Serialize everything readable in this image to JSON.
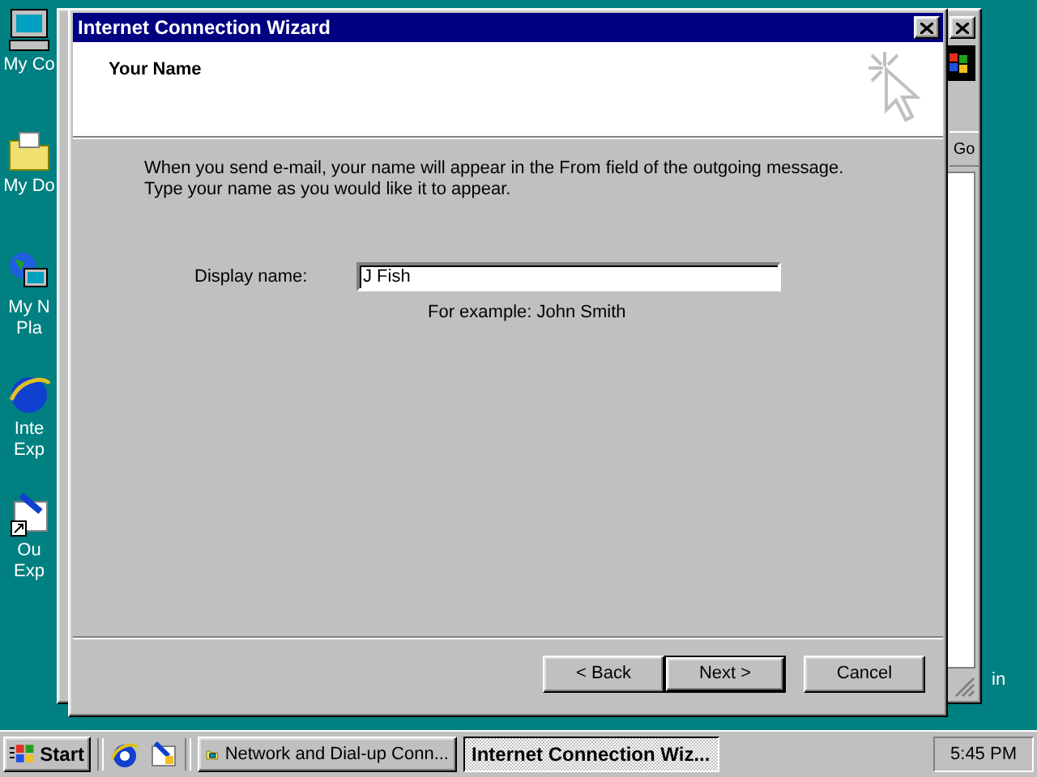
{
  "desktop": {
    "icons": [
      {
        "kind": "computer",
        "lines": [
          "My Co"
        ]
      },
      {
        "kind": "folder",
        "lines": [
          "My Do"
        ]
      },
      {
        "kind": "network",
        "lines": [
          "My N",
          "Pla"
        ]
      },
      {
        "kind": "browser",
        "lines": [
          "Inte",
          "Exp"
        ]
      },
      {
        "kind": "mail",
        "lines": [
          "Ou",
          "Exp"
        ]
      }
    ],
    "right_label": "in"
  },
  "background_window": {
    "go_button": "Go"
  },
  "dialog": {
    "title": "Internet Connection Wizard",
    "header": "Your Name",
    "intro": [
      "When you send e-mail, your name will appear in the From field of the outgoing message.",
      "Type your name as you would like it to appear."
    ],
    "field": {
      "label": "Display name:",
      "value": "J Fish",
      "hint": "For example: John Smith"
    },
    "buttons": [
      {
        "label": "< Back",
        "default": false
      },
      {
        "label": "Next >",
        "default": true
      },
      {
        "label": "Cancel",
        "default": false
      }
    ]
  },
  "taskbar": {
    "start": "Start",
    "tasks": [
      {
        "label": "Network and Dial-up Conn...",
        "selected": false
      },
      {
        "label": "Internet Connection Wiz...",
        "selected": true
      }
    ],
    "clock": "5:45 PM"
  }
}
